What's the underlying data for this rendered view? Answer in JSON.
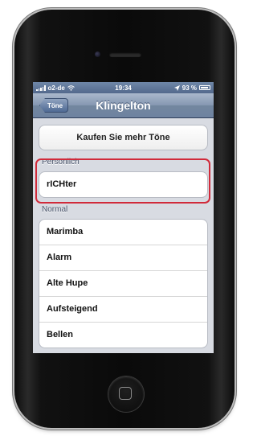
{
  "status_bar": {
    "carrier": "o2-de",
    "time": "19:34",
    "battery": "93 %"
  },
  "nav": {
    "back_label": "Töne",
    "title": "Klingelton"
  },
  "buy_button": {
    "label": "Kaufen Sie mehr Töne"
  },
  "sections": [
    {
      "header": "Persönlich",
      "items": [
        "rICHter"
      ]
    },
    {
      "header": "Normal",
      "items": [
        "Marimba",
        "Alarm",
        "Alte Hupe",
        "Aufsteigend",
        "Bellen"
      ]
    }
  ],
  "icons": [
    "signal-icon",
    "wifi-icon",
    "location-icon",
    "battery-icon",
    "chevron-left-icon",
    "home-button-icon"
  ],
  "colors": {
    "highlight": "#d12a3a",
    "navbar": "#6d82a0"
  }
}
